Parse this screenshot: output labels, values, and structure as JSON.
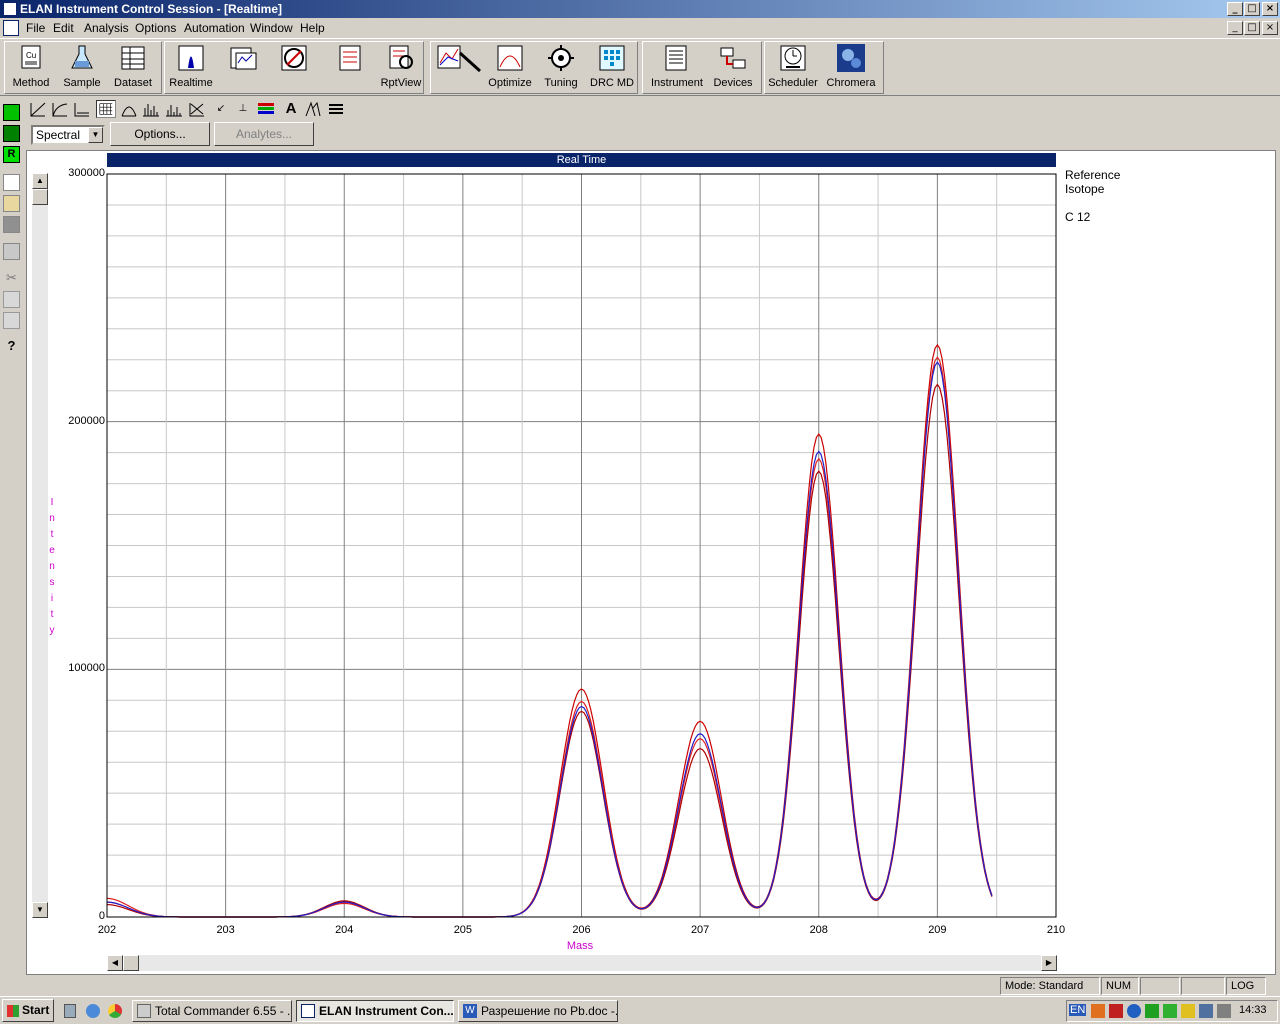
{
  "window": {
    "title": "ELAN Instrument Control Session - [Realtime]",
    "caption_buttons": [
      "_",
      "□",
      "×"
    ]
  },
  "menu": [
    "File",
    "Edit",
    "Analysis",
    "Options",
    "Automation",
    "Window",
    "Help"
  ],
  "toolbar": [
    {
      "label": "Method",
      "icon": "method-icon"
    },
    {
      "label": "Sample",
      "icon": "sample-flask-icon"
    },
    {
      "label": "Dataset",
      "icon": "dataset-icon"
    },
    {
      "label": "Realtime",
      "icon": "realtime-peak-icon"
    },
    {
      "label": "",
      "icon": "report-icon"
    },
    {
      "label": "",
      "icon": "no-entry-icon"
    },
    {
      "label": "",
      "icon": "checklist-icon"
    },
    {
      "label": "RptView",
      "icon": "rptview-icon"
    },
    {
      "label": "",
      "icon": "edit-chart-icon"
    },
    {
      "label": "Optimize",
      "icon": "optimize-icon"
    },
    {
      "label": "Tuning",
      "icon": "tuning-icon"
    },
    {
      "label": "DRC MD",
      "icon": "drc-md-icon"
    },
    {
      "label": "Instrument",
      "icon": "instrument-icon"
    },
    {
      "label": "Devices",
      "icon": "devices-icon"
    },
    {
      "label": "Scheduler",
      "icon": "scheduler-clock-icon"
    },
    {
      "label": "Chromera",
      "icon": "chromera-icon"
    }
  ],
  "view": {
    "mode_select": "Spectral",
    "options_button": "Options...",
    "analytes_button": "Analytes..."
  },
  "chart_data": {
    "type": "line",
    "title": "Real Time",
    "xlabel": "Mass",
    "ylabel": "Intensity",
    "xlim": [
      202,
      210
    ],
    "ylim": [
      0,
      300000
    ],
    "x_ticks": [
      "202",
      "203",
      "204",
      "205",
      "206",
      "207",
      "208",
      "209",
      "210"
    ],
    "y_ticks": [
      "0",
      "100000",
      "200000",
      "300000"
    ],
    "grid": true,
    "legend_lines": [
      "Reference",
      "Isotope",
      "C 12"
    ],
    "series": [
      {
        "color": "#cc0000",
        "peaks": [
          {
            "x": 202.0,
            "y": 6000,
            "w": 0.18
          },
          {
            "x": 204.0,
            "y": 6000,
            "w": 0.17
          },
          {
            "x": 206.0,
            "y": 92000,
            "w": 0.18
          },
          {
            "x": 207.0,
            "y": 79000,
            "w": 0.18
          },
          {
            "x": 208.0,
            "y": 195000,
            "w": 0.17
          },
          {
            "x": 209.0,
            "y": 231000,
            "w": 0.18
          }
        ]
      },
      {
        "color": "#e02020",
        "peaks": [
          {
            "x": 202.0,
            "y": 7500,
            "w": 0.18
          },
          {
            "x": 204.0,
            "y": 5500,
            "w": 0.17
          },
          {
            "x": 206.0,
            "y": 87000,
            "w": 0.18
          },
          {
            "x": 207.0,
            "y": 72000,
            "w": 0.18
          },
          {
            "x": 208.0,
            "y": 185000,
            "w": 0.17
          },
          {
            "x": 209.0,
            "y": 226000,
            "w": 0.18
          }
        ]
      },
      {
        "color": "#b00000",
        "peaks": [
          {
            "x": 202.0,
            "y": 5000,
            "w": 0.18
          },
          {
            "x": 204.0,
            "y": 6500,
            "w": 0.17
          },
          {
            "x": 206.0,
            "y": 83000,
            "w": 0.18
          },
          {
            "x": 207.0,
            "y": 68000,
            "w": 0.18
          },
          {
            "x": 208.0,
            "y": 180000,
            "w": 0.17
          },
          {
            "x": 209.0,
            "y": 215000,
            "w": 0.18
          }
        ]
      },
      {
        "color": "#2020cc",
        "peaks": [
          {
            "x": 202.0,
            "y": 6000,
            "w": 0.18
          },
          {
            "x": 204.0,
            "y": 6000,
            "w": 0.17
          },
          {
            "x": 206.0,
            "y": 85000,
            "w": 0.18
          },
          {
            "x": 207.0,
            "y": 74000,
            "w": 0.18
          },
          {
            "x": 208.0,
            "y": 188000,
            "w": 0.17
          },
          {
            "x": 209.0,
            "y": 224000,
            "w": 0.18
          }
        ]
      }
    ]
  },
  "status": {
    "mode": "Mode: Standard",
    "num": "NUM",
    "log": "LOG"
  },
  "taskbar": {
    "start": "Start",
    "tasks": [
      "Total Commander 6.55 - ...",
      "ELAN Instrument Con...",
      "Разрешение по Pb.doc -..."
    ],
    "lang": "EN",
    "clock": "14:33"
  },
  "colors": {
    "titlebar": "#0a246a",
    "chart_header": "#0a246a",
    "axis_label": "#cc00cc"
  }
}
